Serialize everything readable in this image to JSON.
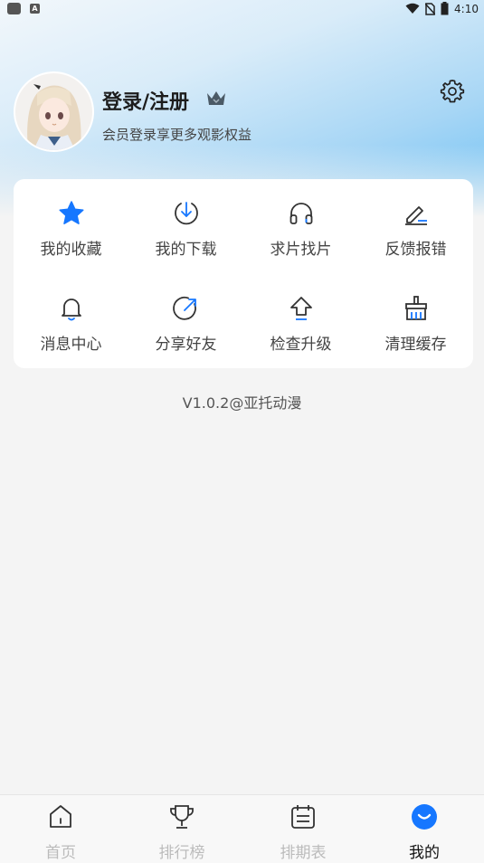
{
  "status_bar": {
    "time": "4:10",
    "icons": [
      "app-icon",
      "a-icon",
      "wifi-icon",
      "no-sim-icon",
      "battery-icon"
    ]
  },
  "profile": {
    "title": "登录/注册",
    "subtitle": "会员登录享更多观影权益",
    "vip_icon": "crown-icon",
    "settings_icon": "gear-icon"
  },
  "menu": {
    "items": [
      {
        "label": "我的收藏",
        "icon": "star-icon"
      },
      {
        "label": "我的下载",
        "icon": "download-icon"
      },
      {
        "label": "求片找片",
        "icon": "headphones-icon"
      },
      {
        "label": "反馈报错",
        "icon": "edit-icon"
      },
      {
        "label": "消息中心",
        "icon": "bell-icon"
      },
      {
        "label": "分享好友",
        "icon": "share-icon"
      },
      {
        "label": "检查升级",
        "icon": "upgrade-icon"
      },
      {
        "label": "清理缓存",
        "icon": "clean-icon"
      }
    ]
  },
  "version": "V1.0.2@亚托动漫",
  "bottom_nav": {
    "items": [
      {
        "label": "首页",
        "icon": "home-icon"
      },
      {
        "label": "排行榜",
        "icon": "trophy-icon"
      },
      {
        "label": "排期表",
        "icon": "calendar-icon"
      },
      {
        "label": "我的",
        "icon": "profile-icon",
        "active": true
      }
    ]
  },
  "colors": {
    "accent": "#1677ff",
    "header_gradient_end": "#6cc0f4",
    "background": "#f4f4f4"
  }
}
